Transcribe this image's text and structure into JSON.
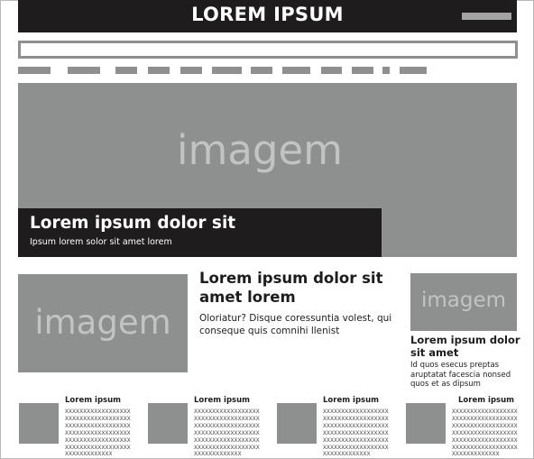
{
  "header": {
    "title": "LOREM IPSUM",
    "menu_icon": "menu-bar-icon"
  },
  "search": {
    "placeholder": ""
  },
  "nav": {
    "items": [
      "",
      "",
      "",
      "",
      "",
      "",
      "",
      "",
      "",
      "",
      ""
    ]
  },
  "hero": {
    "image_placeholder": "imagem",
    "title": "Lorem ipsum dolor sit",
    "subtitle": "Ipsum lorem solor sit amet lorem"
  },
  "featured": {
    "image_placeholder": "imagem",
    "title": "Lorem ipsum dolor sit amet lorem",
    "body": "Oloriatur? Disque coressuntia volest, qui conseque quis comnihi llenist"
  },
  "sidebar_story": {
    "image_placeholder": "imagem",
    "title": "Lorem ipsum dolor sit amet",
    "body": "Id quos esecus preptas aruptatat facescia nonsed quos et as dipsum"
  },
  "cards": [
    {
      "title": "Lorem ipsum",
      "text": "XXXXXXXXXXXXXXXXXXXXXXXXXXXXXXXXXXXXXXXXXXXXXXXXXXXXXXXXXXXXXXXXXXXXXXXXXXXXXXXXXXXXXXXXXXXXXXXXXXXXXXXXXXXXXXXXXXXXXXXXX"
    },
    {
      "title": "Lorem ipsum",
      "text": "XXXXXXXXXXXXXXXXXXXXXXXXXXXXXXXXXXXXXXXXXXXXXXXXXXXXXXXXXXXXXXXXXXXXXXXXXXXXXXXXXXXXXXXXXXXXXXXXXXXXXXXXXXXXXXXXXXXXXXXXX"
    },
    {
      "title": "Lorem ipsum",
      "text": "XXXXXXXXXXXXXXXXXXXXXXXXXXXXXXXXXXXXXXXXXXXXXXXXXXXXXXXXXXXXXXXXXXXXXXXXXXXXXXXXXXXXXXXXXXXXXXXXXXXXXXXXXXXXXXXXXXXXXXXXX"
    },
    {
      "title": "Lorem ipsum",
      "text": "XXXXXXXXXXXXXXXXXXXXXXXXXXXXXXXXXXXXXXXXXXXXXXXXXXXXXXXXXXXXXXXXXXXXXXXXXXXXXXXXXXXXXXXXXXXXXXXXXXXXXXXXXXXXXXXXXXXXXXXXX"
    }
  ]
}
